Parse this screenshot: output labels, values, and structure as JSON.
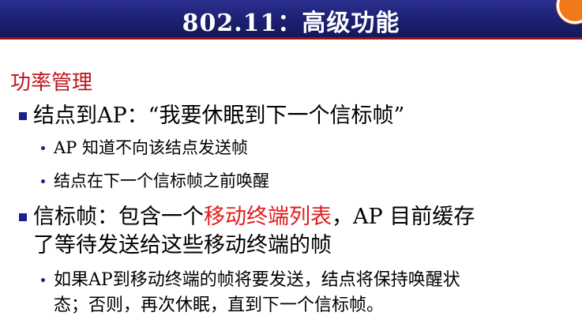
{
  "slide": {
    "title": "802.11：高级功能",
    "section_heading": "功率管理",
    "bullet1": {
      "text": "结点到AP：“我要休眠到下一个信标帧”",
      "sub": [
        "AP 知道不向该结点发送帧",
        "结点在下一个信标帧之前唤醒"
      ]
    },
    "bullet2": {
      "part1": "信标帧：包含一个",
      "highlight": "移动终端列表",
      "part2": "，AP 目前缓存",
      "line2": "了等待发送给这些移动终端的帧",
      "sub": [
        "如果AP到移动终端的帧将要发送，结点将保持唤醒状",
        "态；否则，再次休眠，直到下一个信标帧。"
      ]
    }
  },
  "colors": {
    "title_bar": "#1b1f6e",
    "accent_red": "#c0151b",
    "highlight_red": "#e01c1c",
    "bullet_blue": "#1b1f8f"
  }
}
